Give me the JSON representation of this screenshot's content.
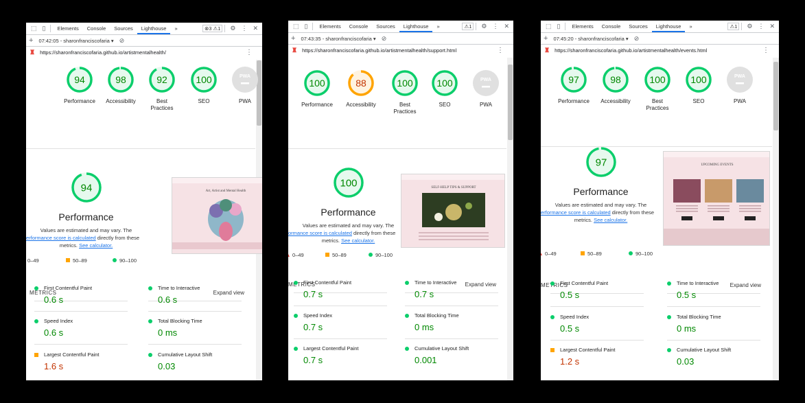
{
  "colors": {
    "pass": "#0cce6b",
    "pass_text": "#008800",
    "average": "#ffa400",
    "average_text": "#c33300",
    "fail": "#e8453c",
    "pwa_gray": "#e0e0e0",
    "link": "#1a73e8"
  },
  "panels": [
    {
      "toolbar": {
        "tabs": [
          "Elements",
          "Console",
          "Sources",
          "Lighthouse"
        ],
        "more": "»",
        "badge": "⊗3 ⚠1"
      },
      "session": "07:42:05 - sharonfranciscofaria ▾",
      "url": "https://sharonfranciscofaria.github.io/artistmentalhealth/",
      "scores": [
        {
          "score": "94",
          "label": "Performance",
          "value": 94,
          "status": "pass"
        },
        {
          "score": "98",
          "label": "Accessibility",
          "value": 98,
          "status": "pass"
        },
        {
          "score": "92",
          "label": "Best Practices",
          "value": 92,
          "status": "pass"
        },
        {
          "score": "100",
          "label": "SEO",
          "value": 100,
          "status": "pass"
        },
        {
          "score": "PWA",
          "label": "PWA",
          "value": 0,
          "status": "pwa"
        }
      ],
      "perf": {
        "score": "94",
        "value": 94,
        "title": "Performance",
        "desc1": "Values are estimated and may vary. The",
        "desc2a": "erformance score is calculated",
        "desc2b": " directly from these",
        "desc3a": "metrics. ",
        "desc3b": "See calculator."
      },
      "legend": [
        "0–49",
        "50–89",
        "90–100"
      ],
      "metrics_heading": "METRICS",
      "expand": "Expand view",
      "metrics": [
        {
          "name": "First Contentful Paint",
          "value": "0.6 s",
          "status": "pass"
        },
        {
          "name": "Time to Interactive",
          "value": "0.6 s",
          "status": "pass"
        },
        {
          "name": "Speed Index",
          "value": "0.6 s",
          "status": "pass"
        },
        {
          "name": "Total Blocking Time",
          "value": "0 ms",
          "status": "pass"
        },
        {
          "name": "Largest Contentful Paint",
          "value": "1.6 s",
          "status": "average"
        },
        {
          "name": "Cumulative Layout Shift",
          "value": "0.03",
          "status": "pass"
        }
      ],
      "preview": {
        "heading": "Art, Artist and Mental Health"
      }
    },
    {
      "toolbar": {
        "tabs": [
          "Elements",
          "Console",
          "Sources",
          "Lighthouse"
        ],
        "more": "»",
        "badge": "⚠1"
      },
      "session": "07:43:35 - sharonfranciscofaria ▾",
      "url": "https://sharonfranciscofaria.github.io/artistmentalhealth/support.html",
      "scores": [
        {
          "score": "100",
          "label": "Performance",
          "value": 100,
          "status": "pass"
        },
        {
          "score": "88",
          "label": "Accessibility",
          "value": 88,
          "status": "average"
        },
        {
          "score": "100",
          "label": "Best Practices",
          "value": 100,
          "status": "pass"
        },
        {
          "score": "100",
          "label": "SEO",
          "value": 100,
          "status": "pass"
        },
        {
          "score": "PWA",
          "label": "PWA",
          "value": 0,
          "status": "pwa"
        }
      ],
      "perf": {
        "score": "100",
        "value": 100,
        "title": "Performance",
        "desc1": "Values are estimated and may vary. The",
        "desc2a": "ormance score is calculated",
        "desc2b": " directly from these",
        "desc3a": "metrics. ",
        "desc3b": "See calculator."
      },
      "legend": [
        "0–49",
        "50–89",
        "90–100"
      ],
      "metrics_heading": "METRICS",
      "expand": "Expand view",
      "metrics": [
        {
          "name": "First Contentful Paint",
          "value": "0.7 s",
          "status": "pass"
        },
        {
          "name": "Time to Interactive",
          "value": "0.7 s",
          "status": "pass"
        },
        {
          "name": "Speed Index",
          "value": "0.7 s",
          "status": "pass"
        },
        {
          "name": "Total Blocking Time",
          "value": "0 ms",
          "status": "pass"
        },
        {
          "name": "Largest Contentful Paint",
          "value": "0.7 s",
          "status": "pass"
        },
        {
          "name": "Cumulative Layout Shift",
          "value": "0.001",
          "status": "pass"
        }
      ],
      "preview": {
        "heading": "SELF-HELP TIPS & SUPPORT"
      }
    },
    {
      "toolbar": {
        "tabs": [
          "Elements",
          "Console",
          "Sources",
          "Lighthouse"
        ],
        "more": "»",
        "badge": "⚠1"
      },
      "session": "07:45:20 - sharonfranciscofaria ▾",
      "url": "https://sharonfranciscofaria.github.io/artistmentalhealth/events.html",
      "scores": [
        {
          "score": "97",
          "label": "Performance",
          "value": 97,
          "status": "pass"
        },
        {
          "score": "98",
          "label": "Accessibility",
          "value": 98,
          "status": "pass"
        },
        {
          "score": "100",
          "label": "Best Practices",
          "value": 100,
          "status": "pass"
        },
        {
          "score": "100",
          "label": "SEO",
          "value": 100,
          "status": "pass"
        },
        {
          "score": "PWA",
          "label": "PWA",
          "value": 0,
          "status": "pwa"
        }
      ],
      "perf": {
        "score": "97",
        "value": 97,
        "title": "Performance",
        "desc1": "Values are estimated and may vary. The",
        "desc2a": "erformance score is calculated",
        "desc2b": " directly from these",
        "desc3a": "metrics. ",
        "desc3b": "See calculator."
      },
      "legend": [
        "0–49",
        "50–89",
        "90–100"
      ],
      "metrics_heading": "METRICS",
      "expand": "Expand view",
      "metrics": [
        {
          "name": "First Contentful Paint",
          "value": "0.5 s",
          "status": "pass"
        },
        {
          "name": "Time to Interactive",
          "value": "0.5 s",
          "status": "pass"
        },
        {
          "name": "Speed Index",
          "value": "0.5 s",
          "status": "pass"
        },
        {
          "name": "Total Blocking Time",
          "value": "0 ms",
          "status": "pass"
        },
        {
          "name": "Largest Contentful Paint",
          "value": "1.2 s",
          "status": "average"
        },
        {
          "name": "Cumulative Layout Shift",
          "value": "0.03",
          "status": "pass"
        }
      ],
      "preview": {
        "heading": "UPCOMING EVENTS"
      }
    }
  ]
}
